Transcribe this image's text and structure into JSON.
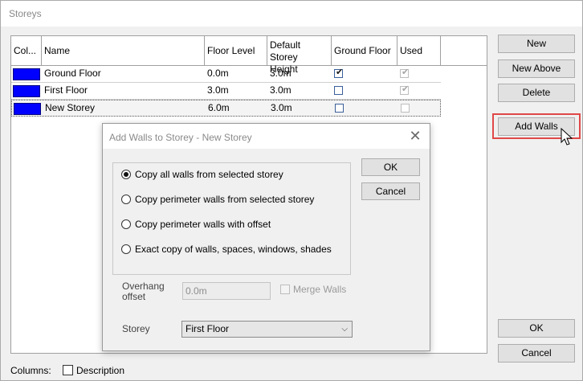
{
  "window": {
    "title": "Storeys"
  },
  "grid": {
    "headers": [
      "Col...",
      "Name",
      "Floor Level",
      "Default Storey Height",
      "Ground Floor",
      "Used"
    ],
    "rows": [
      {
        "name": "Ground Floor",
        "floor_level": "0.0m",
        "height": "3.0m",
        "ground_floor": true,
        "used": true,
        "color": "#0000ff"
      },
      {
        "name": "First Floor",
        "floor_level": "3.0m",
        "height": "3.0m",
        "ground_floor": false,
        "used": true,
        "color": "#0000ff"
      },
      {
        "name": "New Storey",
        "floor_level": "6.0m",
        "height": "3.0m",
        "ground_floor": false,
        "used": false,
        "color": "#0000ff"
      }
    ]
  },
  "buttons": {
    "new": "New",
    "new_above": "New Above",
    "delete": "Delete",
    "add_walls": "Add Walls",
    "ok": "OK",
    "cancel": "Cancel"
  },
  "footer": {
    "columns_label": "Columns:",
    "description_label": "Description"
  },
  "dialog": {
    "title": "Add Walls to Storey - New Storey",
    "close_glyph": "✕",
    "options": [
      "Copy all walls from selected storey",
      "Copy perimeter walls from selected storey",
      "Copy perimeter walls with offset",
      "Exact copy of walls, spaces, windows, shades"
    ],
    "selected_option": 0,
    "overhang_label_1": "Overhang",
    "overhang_label_2": "offset",
    "overhang_value": "0.0m",
    "merge_walls_label": "Merge Walls",
    "storey_label": "Storey",
    "storey_value": "First Floor",
    "ok": "OK",
    "cancel": "Cancel"
  },
  "colors": {
    "highlight": "#e04848",
    "swatch": "#0000ff"
  }
}
